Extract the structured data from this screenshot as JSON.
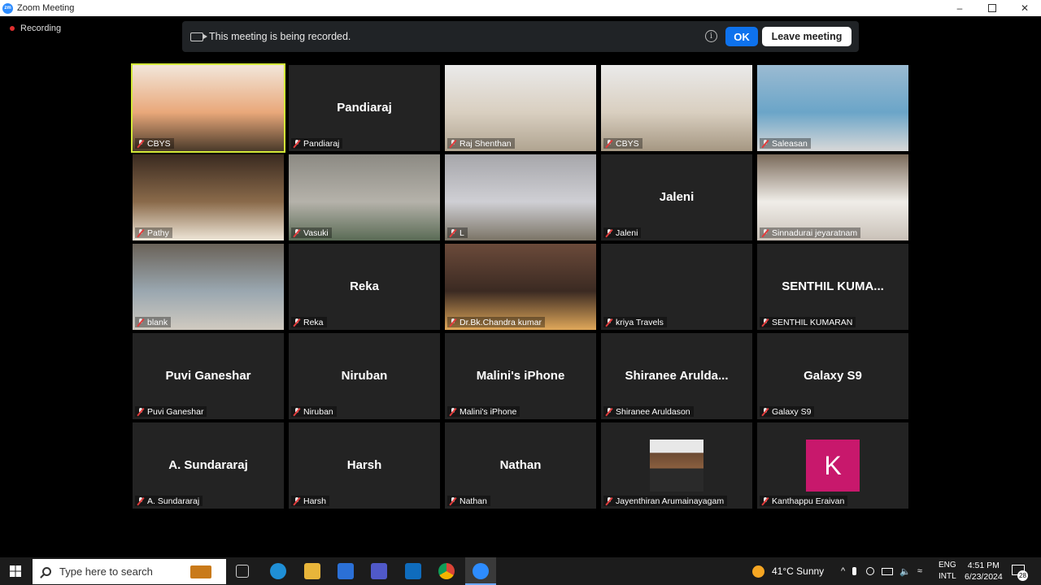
{
  "window": {
    "title": "Zoom Meeting"
  },
  "recording_indicator": "Recording",
  "banner": {
    "message": "This meeting is being recorded.",
    "ok_label": "OK",
    "leave_label": "Leave meeting"
  },
  "tiles": [
    {
      "name": "CBYS",
      "display": "",
      "video": true,
      "active": true
    },
    {
      "name": "Pandiaraj",
      "display": "Pandiaraj",
      "video": false
    },
    {
      "name": "Raj Shenthan",
      "display": "",
      "video": true
    },
    {
      "name": "CBYS",
      "display": "",
      "video": true
    },
    {
      "name": "Saleasan",
      "display": "",
      "video": true
    },
    {
      "name": "Pathy",
      "display": "",
      "video": true
    },
    {
      "name": "Vasuki",
      "display": "",
      "video": true
    },
    {
      "name": "L",
      "display": "",
      "video": true
    },
    {
      "name": "Jaleni",
      "display": "Jaleni",
      "video": false
    },
    {
      "name": "Sinnadurai jeyaratnam",
      "display": "",
      "video": true
    },
    {
      "name": "blank",
      "display": "",
      "video": true
    },
    {
      "name": "Reka",
      "display": "Reka",
      "video": false
    },
    {
      "name": "Dr.Bk.Chandra kumar",
      "display": "",
      "video": true
    },
    {
      "name": "kriya Travels",
      "display": "",
      "video": false
    },
    {
      "name": "SENTHIL KUMARAN",
      "display": "SENTHIL KUMA...",
      "video": false
    },
    {
      "name": "Puvi Ganeshar",
      "display": "Puvi Ganeshar",
      "video": false
    },
    {
      "name": "Niruban",
      "display": "Niruban",
      "video": false
    },
    {
      "name": "Malini's iPhone",
      "display": "Malini's iPhone",
      "video": false
    },
    {
      "name": "Shiranee Aruldason",
      "display": "Shiranee  Arulda...",
      "video": false
    },
    {
      "name": "Galaxy S9",
      "display": "Galaxy S9",
      "video": false
    },
    {
      "name": "A. Sundararaj",
      "display": "A. Sundararaj",
      "video": false
    },
    {
      "name": "Harsh",
      "display": "Harsh",
      "video": false
    },
    {
      "name": "Nathan",
      "display": "Nathan",
      "video": false
    },
    {
      "name": "Jayenthiran Arumainayagam",
      "display": "",
      "video": false,
      "photo": true
    },
    {
      "name": "Kanthappu Eraivan",
      "display": "",
      "video": false,
      "initial": "K"
    }
  ],
  "taskbar": {
    "search_placeholder": "Type here to search",
    "weather": "41°C  Sunny",
    "lang_top": "ENG",
    "lang_bottom": "INTL",
    "time": "4:51 PM",
    "date": "6/23/2024",
    "notification_count": "28"
  }
}
